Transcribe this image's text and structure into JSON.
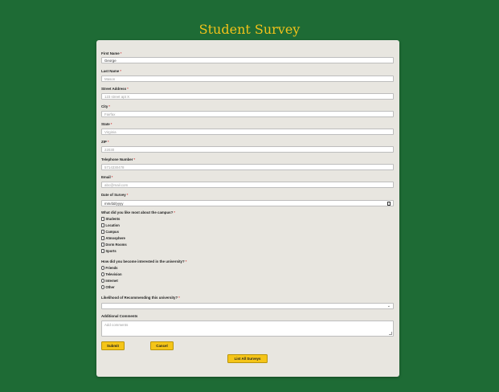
{
  "page_title": "Student Survey",
  "fields": {
    "first_name": {
      "label": "First Name",
      "value": "George"
    },
    "last_name": {
      "label": "Last Name",
      "value": "Mason"
    },
    "street_address": {
      "label": "Street Address",
      "value": "123 street apt X"
    },
    "city": {
      "label": "City",
      "value": "Fairfax"
    },
    "state": {
      "label": "State",
      "value": "Virginia"
    },
    "zip": {
      "label": "ZIP",
      "value": "22030"
    },
    "telephone": {
      "label": "Telephone Number",
      "value": "5714330478"
    },
    "email": {
      "label": "Email",
      "value": "abc@mail.com"
    },
    "date": {
      "label": "Date of Survey",
      "value": "mm/dd/yyyy"
    }
  },
  "campus_question": {
    "label": "What did you like most about the campus?",
    "options": [
      "Students",
      "Location",
      "Campus",
      "Atmosphere",
      "Dorm Rooms",
      "Sports"
    ]
  },
  "interest_question": {
    "label": "How did you become interested in the university?",
    "options": [
      "Friends",
      "Television",
      "Internet",
      "Other"
    ]
  },
  "recommend": {
    "label": "Likelihood of Recommending this university?",
    "value": ""
  },
  "comments": {
    "label": "Additional Comments",
    "placeholder": "Add comments"
  },
  "buttons": {
    "submit": "Submit",
    "cancel": "Cancel",
    "list_all": "List All Surveys"
  },
  "colors": {
    "background": "#1e6b35",
    "title": "#f2c21a",
    "button": "#f5c518",
    "card": "#e8e6e0"
  }
}
